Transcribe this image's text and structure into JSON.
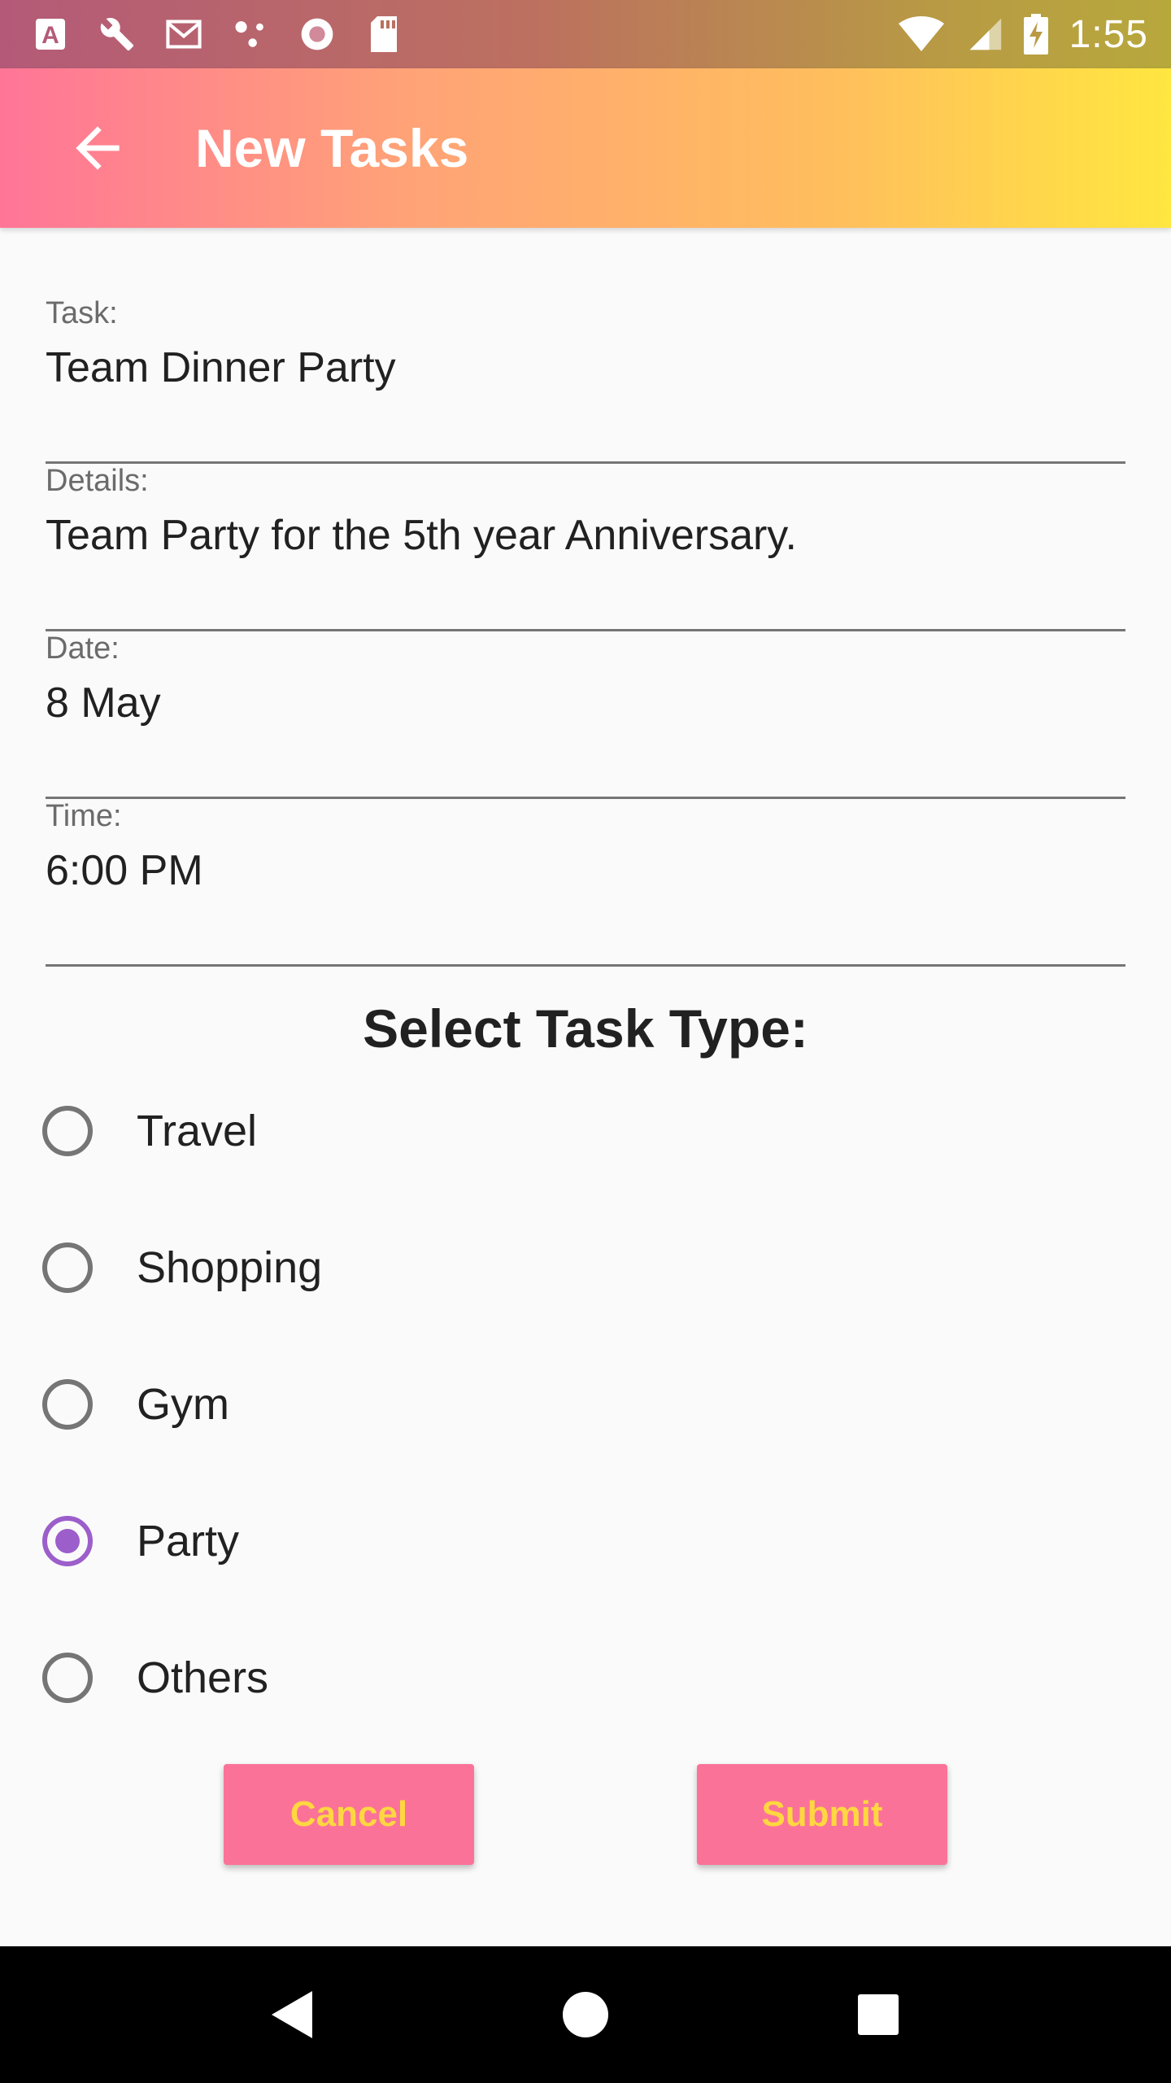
{
  "status_bar": {
    "time": "1:55",
    "icons": [
      "font-a-icon",
      "wrench-icon",
      "gmail-icon",
      "dots-icon",
      "record-icon",
      "sd-card-icon",
      "wifi-icon",
      "signal-icon",
      "battery-charging-icon"
    ]
  },
  "app_bar": {
    "title": "New Tasks",
    "back_icon": "arrow-back-icon",
    "gradient": [
      "#ff7597",
      "#ffbd5e",
      "#ffe640"
    ]
  },
  "form": {
    "task": {
      "label": "Task:",
      "value": "Team Dinner Party"
    },
    "details": {
      "label": "Details:",
      "value": "Team Party for the 5th year Anniversary."
    },
    "date": {
      "label": "Date:",
      "value": "8 May"
    },
    "time": {
      "label": "Time:",
      "value": "6:00 PM"
    }
  },
  "task_type": {
    "title": "Select Task Type:",
    "options": [
      {
        "label": "Travel",
        "checked": false
      },
      {
        "label": "Shopping",
        "checked": false
      },
      {
        "label": "Gym",
        "checked": false
      },
      {
        "label": "Party",
        "checked": true
      },
      {
        "label": "Others",
        "checked": false
      }
    ],
    "accent_color": "#9c5ecb"
  },
  "buttons": {
    "cancel_label": "Cancel",
    "submit_label": "Submit",
    "background": "#fb7299",
    "text_color": "#ffd740"
  },
  "nav_bar": {
    "icons": [
      "back-triangle-icon",
      "home-circle-icon",
      "recents-square-icon"
    ]
  }
}
